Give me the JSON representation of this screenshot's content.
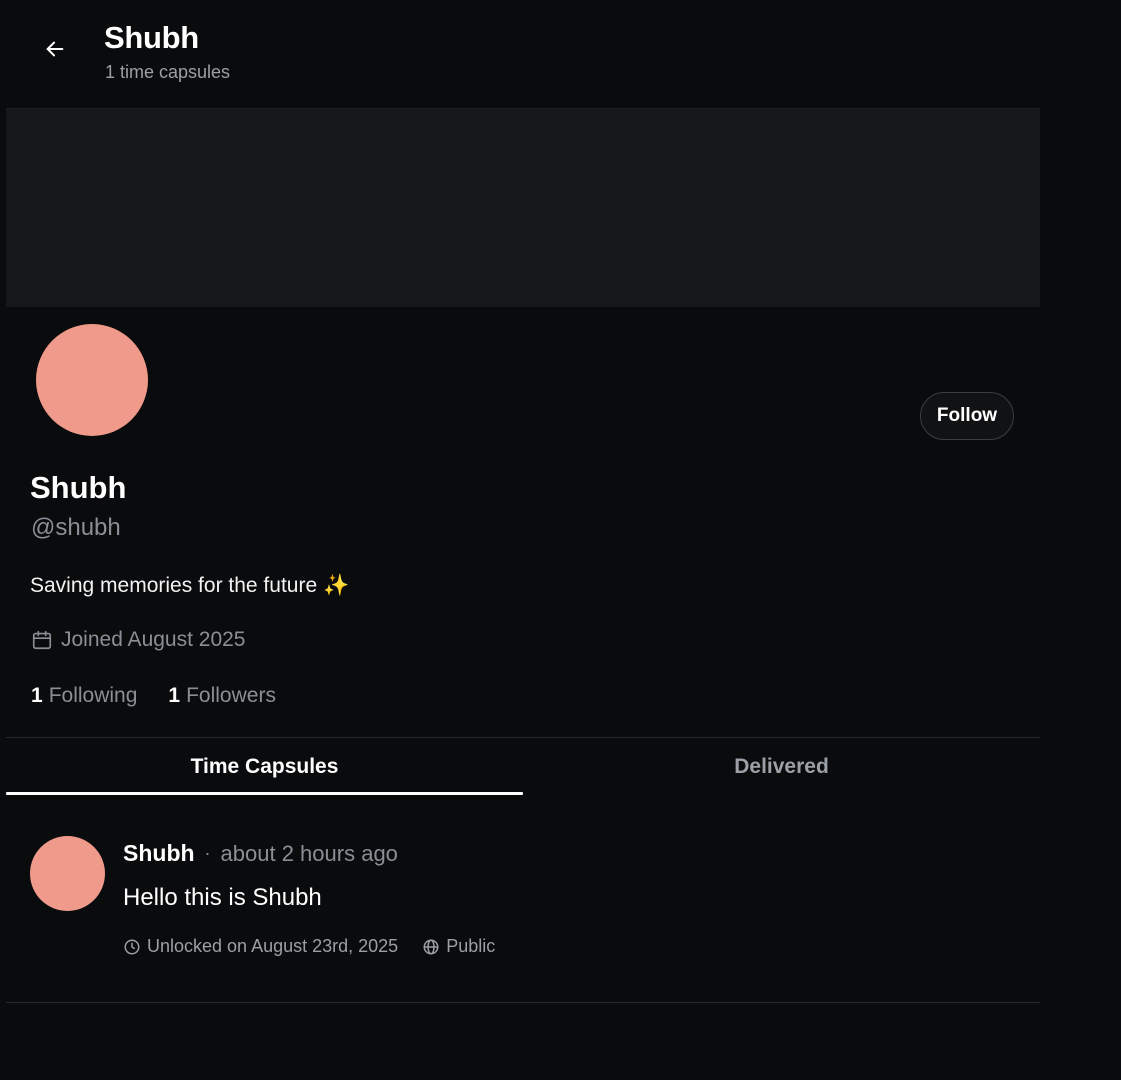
{
  "header": {
    "title": "Shubh",
    "subtitle": "1 time capsules"
  },
  "profile": {
    "name": "Shubh",
    "handle": "@shubh",
    "bio": "Saving memories for the future",
    "bio_emoji": "✨",
    "joined": "Joined August 2025",
    "following_count": "1",
    "following_label": "Following",
    "followers_count": "1",
    "followers_label": "Followers",
    "follow_label": "Follow",
    "avatar_color": "#ef9a8b"
  },
  "tabs": [
    {
      "label": "Time Capsules",
      "active": true
    },
    {
      "label": "Delivered",
      "active": false
    }
  ],
  "posts": [
    {
      "author": "Shubh",
      "separator": "·",
      "time": "about 2 hours ago",
      "text": "Hello this is Shubh",
      "unlock": "Unlocked on August 23rd, 2025",
      "visibility": "Public"
    }
  ],
  "colors": {
    "background": "#0a0b0d",
    "banner": "#161719",
    "muted_text": "#8a8f96",
    "avatar": "#ef9a8b"
  }
}
